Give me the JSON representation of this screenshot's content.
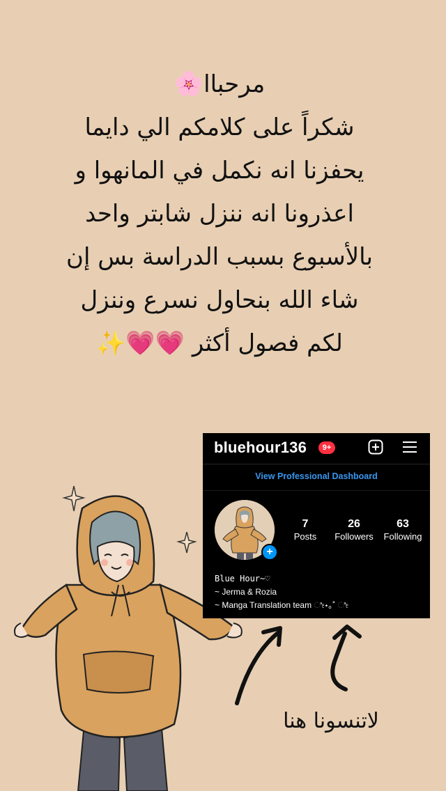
{
  "message": {
    "lines": [
      "مرحباا🌸",
      "شكراً على كلامكم الي دايما",
      "يحفزنا انه نكمل في المانهوا و",
      "اعذرونا انه ننزل شابتر واحد",
      "بالأسبوع بسبب الدراسة بس إن",
      "شاء الله بنحاول نسرع وننزل",
      "لكم فصول أكثر 💗💗✨"
    ]
  },
  "instagram": {
    "username": "bluehour136",
    "notification_badge": "9+",
    "dashboard_link": "View Professional Dashboard",
    "stats": [
      {
        "value": "7",
        "label": "Posts"
      },
      {
        "value": "26",
        "label": "Followers"
      },
      {
        "value": "63",
        "label": "Following"
      }
    ],
    "bio": [
      "Blue Hour~♡",
      "~ Jerma & Rozia",
      "~ Manga Translation team ೀ⋆｡˚ ೀ"
    ]
  },
  "hint": "لاتنسونا هنا",
  "colors": {
    "background": "#e8cfb3",
    "hoodie": "#d9a25e",
    "instagram_blue": "#3897f0",
    "badge_red": "#ff3040"
  }
}
